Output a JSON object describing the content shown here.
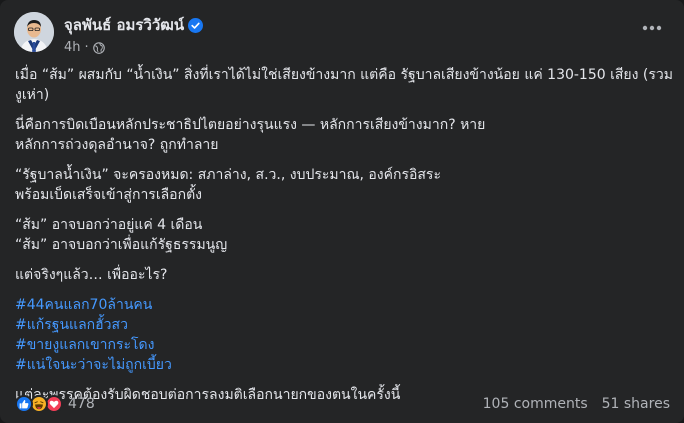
{
  "post": {
    "author": "จุลพันธ์ อมรวิวัฒน์",
    "time": "4h",
    "separator": "·",
    "colors": {
      "link": "#4599ff",
      "verified": "#1877f2",
      "card": "#242526"
    },
    "icons": {
      "verified": "verified-badge-icon",
      "audience": "globe-icon",
      "more": "more-horizontal-icon"
    },
    "paragraphs": [
      [
        "เมื่อ “ส้ม” ผสมกับ “น้ำเงิน” สิ่งที่เราได้ไม่ใช่เสียงข้างมาก แต่คือ รัฐบาลเสียงข้างน้อย แค่ 130-150 เสียง (รวม",
        "งูเห่า)"
      ],
      [
        "นี่คือการบิดเบือนหลักประชาธิปไตยอย่างรุนแรง — หลักการเสียงข้างมาก? หาย",
        "หลักการถ่วงดุลอำนาจ? ถูกทำลาย"
      ],
      [
        "“รัฐบาลน้ำเงิน” จะครองหมด: สภาล่าง, ส.ว., งบประมาณ, องค์กรอิสระ",
        "พร้อมเบ็ดเสร็จเข้าสู่การเลือกตั้ง"
      ],
      [
        "“ส้ม” อาจบอกว่าอยู่แค่ 4 เดือน",
        "“ส้ม” อาจบอกว่าเพื่อแก้รัฐธรรมนูญ"
      ],
      [
        "แต่จริงๆแล้ว… เพื่ออะไร?"
      ]
    ],
    "hashtags": [
      "#44คนแลก70ล้านคน",
      "#แก้รฐนแลกฮั้วสว",
      "#ขายงูแลกเขากระโดง",
      "#แน่ใจนะว่าจะไม่ถูกเบี้ยว"
    ],
    "closing": "แต่ละพรรคต้องรับผิดชอบต่อการลงมติเลือกนายกของตนในครั้งนี้",
    "reactions": {
      "icons": [
        "like-icon",
        "haha-icon",
        "love-icon"
      ],
      "count": "478"
    },
    "comments": "105 comments",
    "shares": "51 shares"
  }
}
